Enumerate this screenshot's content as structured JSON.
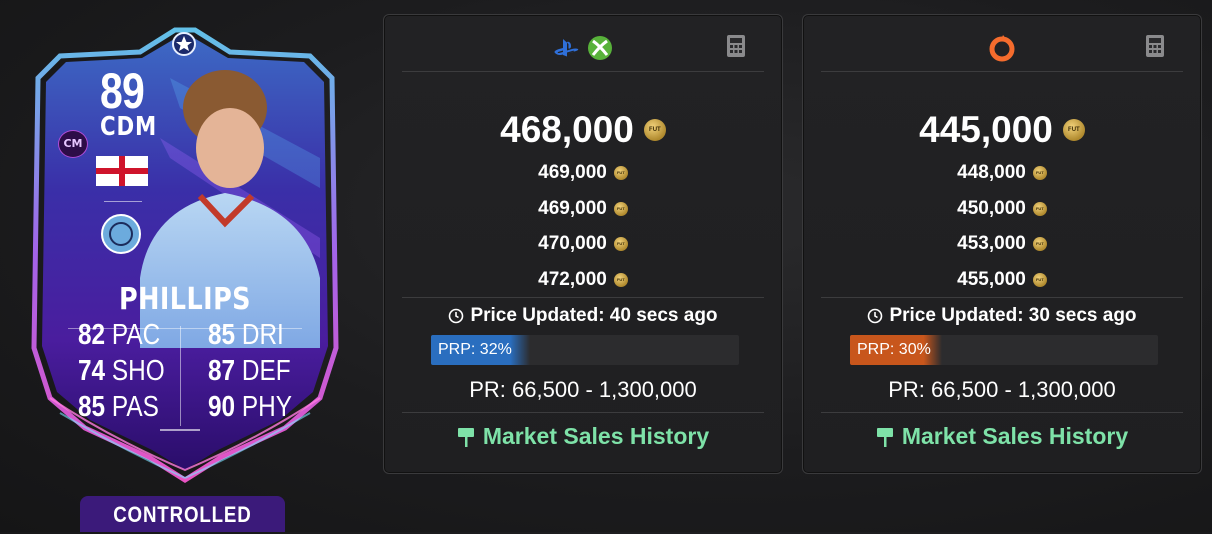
{
  "card": {
    "rating": "89",
    "position": "CDM",
    "alt_position": "CM",
    "name": "PHILLIPS",
    "stats_left": [
      {
        "value": "82",
        "label": "PAC"
      },
      {
        "value": "74",
        "label": "SHO"
      },
      {
        "value": "85",
        "label": "PAS"
      }
    ],
    "stats_right": [
      {
        "value": "85",
        "label": "DRI"
      },
      {
        "value": "87",
        "label": "DEF"
      },
      {
        "value": "90",
        "label": "PHY"
      }
    ],
    "controlled_label": "CONTROLLED"
  },
  "coin_text": "FUT",
  "panels": [
    {
      "platform": "playstation-xbox",
      "price": "468,000",
      "lower_prices": [
        "469,000",
        "469,000",
        "470,000",
        "472,000"
      ],
      "updated": "Price Updated: 40 secs ago",
      "prp_label": "PRP: 32%",
      "prp_percent": 32,
      "prp_color": "#2a6ebf",
      "price_range": "PR: 66,500 - 1,300,000",
      "market_link": "Market Sales History"
    },
    {
      "platform": "origin-pc",
      "price": "445,000",
      "lower_prices": [
        "448,000",
        "450,000",
        "453,000",
        "455,000"
      ],
      "updated": "Price Updated: 30 secs ago",
      "prp_label": "PRP: 30%",
      "prp_percent": 30,
      "prp_color": "#c8561c",
      "price_range": "PR: 66,500 - 1,300,000",
      "market_link": "Market Sales History"
    }
  ],
  "colors": {
    "link_green": "#7ee2a8",
    "card_purple": "#3b1a7a",
    "gold": "#c9a448"
  }
}
